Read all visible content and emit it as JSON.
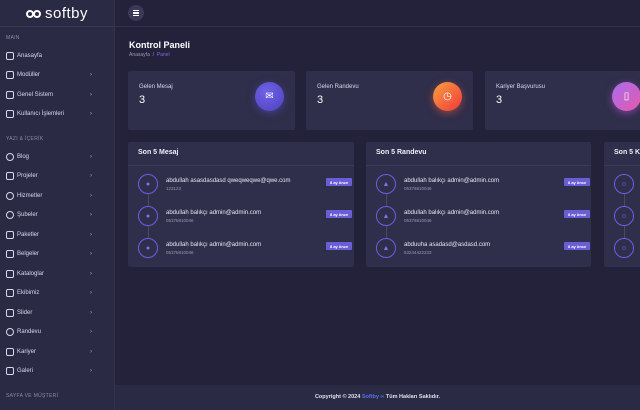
{
  "brand": "softby",
  "sidebar": {
    "sections": [
      {
        "title": "MAIN",
        "items": [
          {
            "label": "Anasayfa",
            "icon": "home-icon",
            "chevron": false
          },
          {
            "label": "Modüller",
            "icon": "modules-icon",
            "chevron": true
          },
          {
            "label": "Genel Sistem",
            "icon": "gear-icon",
            "chevron": true
          },
          {
            "label": "Kullanıcı İşlemleri",
            "icon": "user-icon",
            "chevron": true
          }
        ]
      },
      {
        "title": "YAZI & İÇERİK",
        "items": [
          {
            "label": "Blog",
            "icon": "info-icon",
            "chevron": true
          },
          {
            "label": "Projeler",
            "icon": "folder-icon",
            "chevron": true
          },
          {
            "label": "Hizmetler",
            "icon": "globe-icon",
            "chevron": true
          },
          {
            "label": "Şubeler",
            "icon": "location-icon",
            "chevron": true
          },
          {
            "label": "Paketler",
            "icon": "server-icon",
            "chevron": true
          },
          {
            "label": "Belgeler",
            "icon": "file-icon",
            "chevron": true
          },
          {
            "label": "Kataloglar",
            "icon": "book-icon",
            "chevron": true
          },
          {
            "label": "Ekibimiz",
            "icon": "users-icon",
            "chevron": true
          },
          {
            "label": "Slider",
            "icon": "camera-icon",
            "chevron": true
          },
          {
            "label": "Randevu",
            "icon": "clock-icon",
            "chevron": true
          },
          {
            "label": "Kariyer",
            "icon": "bookmark-icon",
            "chevron": true
          },
          {
            "label": "Galeri",
            "icon": "photo-icon",
            "chevron": true
          }
        ]
      },
      {
        "title": "SAYFA VE MÜŞTERİ",
        "items": []
      }
    ]
  },
  "page": {
    "title": "Kontrol Paneli",
    "breadcrumb": [
      "Anasayfa",
      "Panel"
    ]
  },
  "stats": [
    {
      "label": "Gelen Mesaj",
      "value": "3",
      "icon": "mail-icon",
      "color": "#5b4fd0"
    },
    {
      "label": "Gelen Randevu",
      "value": "3",
      "icon": "clock-icon",
      "color": "#f2603a"
    },
    {
      "label": "Kariyer Başvurusu",
      "value": "3",
      "icon": "bookmark-icon",
      "color": "#c45ad8"
    }
  ],
  "panels": [
    {
      "title": "Son 5 Mesaj",
      "icon": "chat-icon",
      "rows": [
        {
          "name": "abdullah asasdasdasd qweqweqwe@qwe.com",
          "sub": "123123",
          "badge": "8 ay önce"
        },
        {
          "name": "abdullah balıkçı admin@admin.com",
          "sub": "05376810046",
          "badge": "8 ay önce"
        },
        {
          "name": "abdullah balıkçı admin@admin.com",
          "sub": "05376810046",
          "badge": "8 ay önce"
        }
      ]
    },
    {
      "title": "Son 5 Randevu",
      "icon": "thumbs-up-icon",
      "rows": [
        {
          "name": "abdullah balıkçı admin@admin.com",
          "sub": "05376810046",
          "badge": "8 ay önce"
        },
        {
          "name": "abdullah balıkçı admin@admin.com",
          "sub": "05376810046",
          "badge": "8 ay önce"
        },
        {
          "name": "abduuha asadasd@asdasd.com",
          "sub": "53244422233",
          "badge": "8 ay önce"
        }
      ]
    },
    {
      "title": "Son 5 K",
      "icon": "user-plus-icon",
      "rows": [
        {
          "name": "",
          "sub": "",
          "badge": ""
        },
        {
          "name": "",
          "sub": "",
          "badge": ""
        },
        {
          "name": "",
          "sub": "",
          "badge": ""
        }
      ]
    }
  ],
  "footer": {
    "prefix": "Copyright © 2024",
    "brand": "Softby",
    "suffix": "Tüm Hakları Saklıdır."
  }
}
